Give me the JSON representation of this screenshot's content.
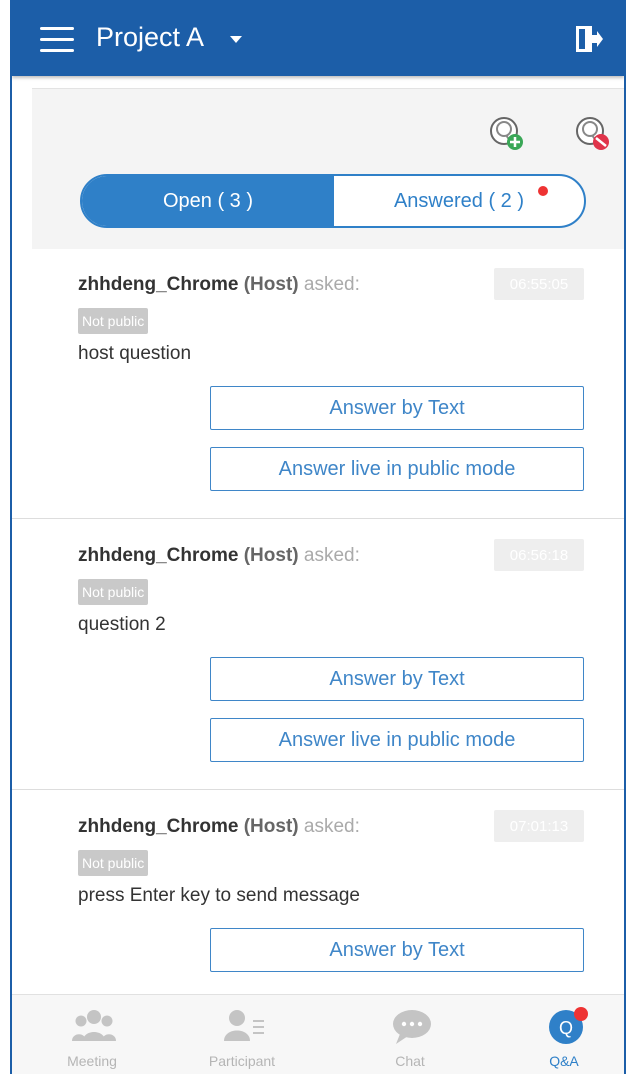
{
  "header": {
    "project_name": "Project A"
  },
  "tabs": {
    "open_label": "Open ( 3 )",
    "answered_label": "Answered ( 2 )"
  },
  "questions": [
    {
      "asker": "zhhdeng_Chrome",
      "role": "(Host)",
      "asked": "asked:",
      "time": "06:55:05",
      "badge": "Not public",
      "text": "host question",
      "answer_text_label": "Answer by Text",
      "answer_live_label": "Answer live in public mode"
    },
    {
      "asker": "zhhdeng_Chrome",
      "role": "(Host)",
      "asked": "asked:",
      "time": "06:56:18",
      "badge": "Not public",
      "text": "question 2",
      "answer_text_label": "Answer by Text",
      "answer_live_label": "Answer live in public mode"
    },
    {
      "asker": "zhhdeng_Chrome",
      "role": "(Host)",
      "asked": "asked:",
      "time": "07:01:13",
      "badge": "Not public",
      "text": "press Enter key to send message",
      "answer_text_label": "Answer by Text"
    }
  ],
  "bottom_nav": [
    {
      "label": "Meeting",
      "icon": "meeting-icon"
    },
    {
      "label": "Participant",
      "icon": "participant-icon"
    },
    {
      "label": "Chat",
      "icon": "chat-icon"
    },
    {
      "label": "Q&A",
      "icon": "qa-icon"
    }
  ],
  "colors": {
    "primary": "#1c5ea8",
    "accent": "#2f80c8",
    "notify": "#ee3333"
  }
}
